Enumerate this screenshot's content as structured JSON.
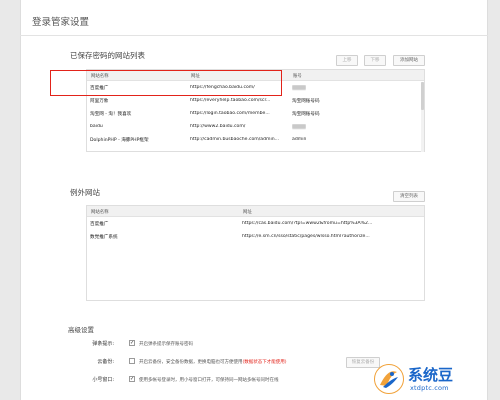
{
  "page": {
    "title": "登录管家设置"
  },
  "saved_sites": {
    "title": "已保存密码的网站列表",
    "buttons": {
      "up": "上移",
      "down": "下移",
      "add": "添加网站"
    },
    "columns": [
      "网站名称",
      "网址",
      "账号"
    ],
    "rows": [
      {
        "name": "百度推广",
        "url": "https://fengchao.baidu.com/",
        "account": "",
        "blurred": true
      },
      {
        "name": "阿里万象",
        "url": "https://everyhelp.taobao.com/scr...",
        "account": "淘宝网账号码",
        "blurred": false
      },
      {
        "name": "淘宝网 - 淘！我喜欢",
        "url": "https://login.taobao.com/membe...",
        "account": "淘宝网账号码",
        "blurred": false
      },
      {
        "name": "baidu",
        "url": "http://www2.baidu.com/",
        "account": "",
        "blurred": true
      },
      {
        "name": "DolphinPHP - 海豚PHP框架",
        "url": "http://cadmin.busbaoche.com/admin...",
        "account": "admin",
        "blurred": false
      }
    ]
  },
  "excluded_sites": {
    "title": "例外网站",
    "buttons": {
      "clear": "清空列表"
    },
    "columns": [
      "网站名称",
      "网址"
    ],
    "rows": [
      {
        "name": "百度推广",
        "url": "https://cas.baidu.com/?tpl=www2&fromu=http%3A%2..."
      },
      {
        "name": "数党推广系统",
        "url": "https://e.sm.cn/sso/static/pages/wlsso.html?authorize..."
      }
    ]
  },
  "advanced": {
    "title": "高级设置",
    "rows": [
      {
        "label": "弹条提示:",
        "checked": true,
        "text": "开启弹条提示保存账号密码",
        "note": "",
        "extra_button": ""
      },
      {
        "label": "云备份:",
        "checked": false,
        "text": "开启云备份，安全备份数据，更换电脑也可方便使用",
        "note": "(数据状态下才能使用)",
        "extra_button": "恢复云备份"
      },
      {
        "label": "小号窗口:",
        "checked": true,
        "text": "使用多帐号登录时，用小号窗口打开，可保持同一网站多帐号同时在线",
        "note": "",
        "extra_button": ""
      }
    ]
  },
  "watermark": {
    "brand": "系统豆",
    "domain": "xtdptc.com"
  },
  "colors": {
    "highlight": "#e2231a",
    "brand": "#1a66c9"
  }
}
